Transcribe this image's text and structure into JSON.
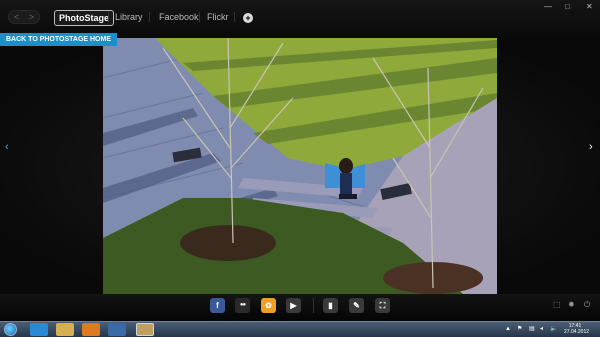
{
  "header": {
    "back_glyph": "<",
    "forward_glyph": ">",
    "tabs": [
      {
        "label": "PhotoStage",
        "active": true
      },
      {
        "label": "Library",
        "active": false
      },
      {
        "label": "Facebook",
        "active": false
      },
      {
        "label": "Flickr",
        "active": false
      }
    ],
    "add_glyph": "+",
    "window_controls": {
      "minimize": "—",
      "maximize": "□",
      "close": "✕"
    }
  },
  "back_home_label": "BACK TO PHOTOSTAGE HOME",
  "viewer": {
    "prev_glyph": "‹",
    "next_glyph": "›"
  },
  "toolbar": {
    "share_icons": [
      {
        "name": "facebook-icon",
        "glyph": "f",
        "color": "#3b5998"
      },
      {
        "name": "flickr-icon",
        "glyph": "●●",
        "color": "#2a2a2a"
      },
      {
        "name": "photostage-icon",
        "glyph": "✿",
        "color": "#f0a020"
      },
      {
        "name": "play-icon",
        "glyph": "▶",
        "color": "#3a3a3a"
      }
    ],
    "tool_icons": [
      {
        "name": "delete-icon",
        "glyph": "▮",
        "color": "#3a3a3a"
      },
      {
        "name": "edit-icon",
        "glyph": "✎",
        "color": "#3a3a3a"
      },
      {
        "name": "crop-icon",
        "glyph": "⛶",
        "color": "#3a3a3a"
      }
    ],
    "right_icons": [
      {
        "name": "fullscreen-icon",
        "glyph": "⬚"
      },
      {
        "name": "settings-icon",
        "glyph": "✹"
      },
      {
        "name": "power-icon",
        "glyph": "⏻"
      }
    ]
  },
  "taskbar": {
    "apps": [
      {
        "name": "ie-icon",
        "color": "#2a8ad6"
      },
      {
        "name": "explorer-icon",
        "color": "#d6b050"
      },
      {
        "name": "media-player-icon",
        "color": "#e07a20"
      },
      {
        "name": "dell-icon",
        "color": "#3a6aa8"
      },
      {
        "name": "photostage-taskbar-icon",
        "color": "#c0a060"
      }
    ],
    "tray_glyphs": [
      "▲",
      "⚑",
      "▤",
      "◂",
      "🔈"
    ],
    "time": "17:41",
    "date": "27.04.2012"
  }
}
